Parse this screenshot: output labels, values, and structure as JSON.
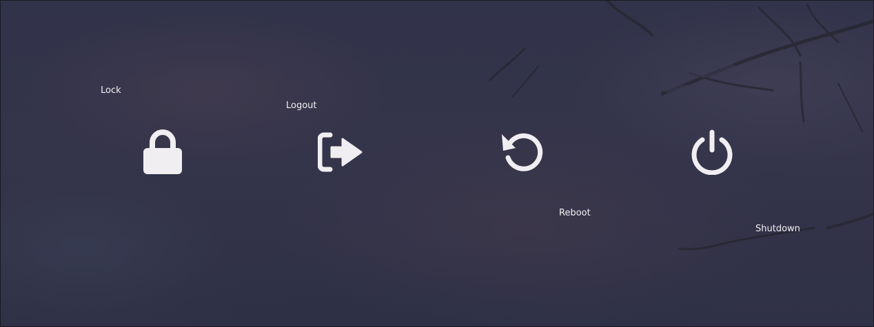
{
  "colors": {
    "icon": "#f1eef2",
    "label": "#f2f0f2",
    "background": "#33344a"
  },
  "actions": [
    {
      "id": "lock",
      "label": "Lock",
      "icon": "lock-icon"
    },
    {
      "id": "logout",
      "label": "Logout",
      "icon": "logout-icon"
    },
    {
      "id": "reboot",
      "label": "Reboot",
      "icon": "reboot-icon"
    },
    {
      "id": "shutdown",
      "label": "Shutdown",
      "icon": "power-icon"
    }
  ]
}
